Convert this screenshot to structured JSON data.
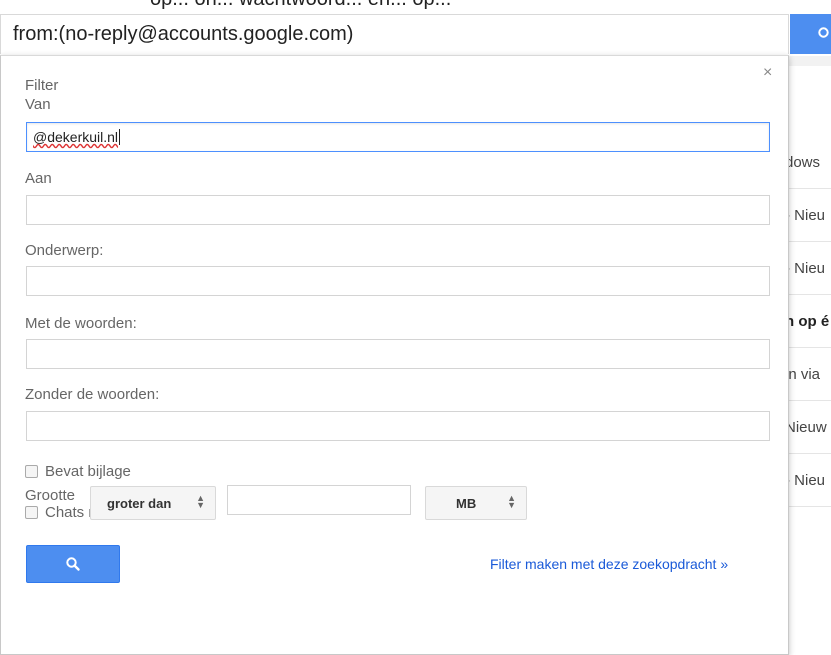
{
  "background": {
    "top_text": "op... on... wachtwoord... en... op...",
    "rows": [
      {
        "text": "dows",
        "bold": false
      },
      {
        "text": "- Nieu",
        "bold": false
      },
      {
        "text": "- Nieu",
        "bold": false
      },
      {
        "text": "n op é",
        "bold": true
      },
      {
        "text": "in via",
        "bold": false
      },
      {
        "text": "Nieuw",
        "bold": false
      },
      {
        "text": "- Nieu",
        "bold": false
      }
    ]
  },
  "search": {
    "query": "from:(no-reply@accounts.google.com)"
  },
  "filter": {
    "title": "Filter",
    "close": "×",
    "from_label": "Van",
    "from_value": "@dekerkuil.nl",
    "to_label": "Aan",
    "to_value": "",
    "subject_label": "Onderwerp:",
    "subject_value": "",
    "has_words_label": "Met de woorden:",
    "has_words_value": "",
    "without_words_label": "Zonder de woorden:",
    "without_words_value": "",
    "has_attachment_label": "Bevat bijlage",
    "has_attachment_checked": false,
    "exclude_chats_label": "Chats niet opnemen",
    "exclude_chats_checked": false,
    "size_label": "Grootte",
    "size_operator": "groter dan",
    "size_value": "",
    "size_unit": "MB",
    "create_filter_link": "Filter maken met deze zoekopdracht »"
  },
  "colors": {
    "accent_blue": "#4d8ef0",
    "link_blue": "#1a5ad8",
    "focus_border": "#4d90fe"
  },
  "icons": {
    "search_button_icon": "search-icon",
    "close_icon": "close-icon"
  }
}
